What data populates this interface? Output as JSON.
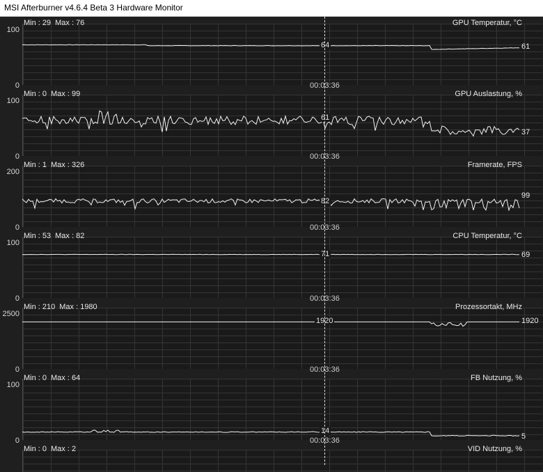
{
  "window": {
    "title": "MSI Afterburner v4.6.4 Beta 3 Hardware Monitor"
  },
  "cursor_time": "00:03:36",
  "graphs": [
    {
      "name": "GPU Temperatur, °C",
      "min_label": "Min : 29",
      "max_label": "Max : 76",
      "ymax": "100",
      "ymin": "0",
      "cursor_value": "64",
      "last_value": "61",
      "trace": {
        "base": 64,
        "end": 61,
        "noise": 0.6,
        "scale_max": 100,
        "profile": "temp"
      }
    },
    {
      "name": "GPU Auslastung, %",
      "min_label": "Min : 0",
      "max_label": "Max : 99",
      "ymax": "100",
      "ymin": "0",
      "cursor_value": "61",
      "last_value": "37",
      "trace": {
        "base": 58,
        "end": 37,
        "noise": 7,
        "scale_max": 100,
        "profile": "load"
      }
    },
    {
      "name": "Framerate, FPS",
      "min_label": "Min : 1",
      "max_label": "Max : 326",
      "ymax": "200",
      "ymin": "0",
      "cursor_value": "82",
      "last_value": "99",
      "trace": {
        "base": 85,
        "end": 99,
        "noise": 7,
        "scale_max": 200,
        "profile": "fps"
      }
    },
    {
      "name": "CPU Temperatur, °C",
      "min_label": "Min : 53",
      "max_label": "Max : 82",
      "ymax": "100",
      "ymin": "0",
      "cursor_value": "71",
      "last_value": "69",
      "trace": {
        "base": 71,
        "end": 69,
        "noise": 0.5,
        "scale_max": 100,
        "profile": "flat"
      }
    },
    {
      "name": "Prozessortakt, MHz",
      "min_label": "Min : 210",
      "max_label": "Max : 1980",
      "ymax": "2500",
      "ymin": "0",
      "cursor_value": "1920",
      "last_value": "1920",
      "trace": {
        "base": 1920,
        "end": 1920,
        "noise": 0,
        "scale_max": 2500,
        "profile": "clock"
      }
    },
    {
      "name": "FB Nutzung, %",
      "min_label": "Min : 0",
      "max_label": "Max : 64",
      "ymax": "100",
      "ymin": "0",
      "cursor_value": "14",
      "last_value": "5",
      "trace": {
        "base": 13,
        "end": 5,
        "noise": 1.2,
        "scale_max": 100,
        "profile": "fb"
      }
    },
    {
      "name": "VID Nutzung, %",
      "min_label": "Min : 0",
      "max_label": "Max : 2",
      "ymax": "",
      "ymin": "",
      "cursor_value": "",
      "last_value": "",
      "trace": null
    }
  ]
}
